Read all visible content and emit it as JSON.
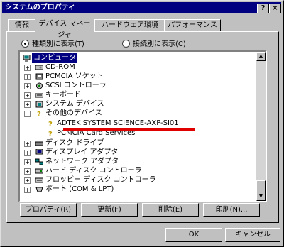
{
  "window": {
    "title": "システムのプロパティ",
    "help_btn": "?",
    "close_btn": "×"
  },
  "tabs": [
    {
      "label": "情報",
      "active": false
    },
    {
      "label": "デバイス マネージャ",
      "active": true
    },
    {
      "label": "ハードウェア環境",
      "active": false
    },
    {
      "label": "パフォーマンス",
      "active": false
    }
  ],
  "view": {
    "by_type": "種類別に表示(T)",
    "by_connection": "接続別に表示(C)",
    "selected": "by_type"
  },
  "tree": [
    {
      "label": "コンピュータ",
      "selected": true,
      "icon": "computer-icon"
    },
    {
      "label": "CD-ROM",
      "icon": "cdrom-icon"
    },
    {
      "label": "PCMCIA ソケット",
      "icon": "pcmcia-icon"
    },
    {
      "label": "SCSI コントローラ",
      "icon": "scsi-icon"
    },
    {
      "label": "キーボード",
      "icon": "keyboard-icon"
    },
    {
      "label": "システム デバイス",
      "icon": "system-device-icon"
    },
    {
      "label": "その他のデバイス",
      "icon": "question-icon"
    },
    {
      "label": "ADTEK SYSTEM SCIENCE-AXP-SI01",
      "icon": "question-icon"
    },
    {
      "label": "PCMCIA Card Services",
      "icon": "question-icon"
    },
    {
      "label": "ディスク ドライブ",
      "icon": "disk-drive-icon"
    },
    {
      "label": "ディスプレイ アダプタ",
      "icon": "display-adapter-icon"
    },
    {
      "label": "ネットワーク アダプタ",
      "icon": "network-adapter-icon"
    },
    {
      "label": "ハード ディスク コントローラ",
      "icon": "hdd-controller-icon"
    },
    {
      "label": "フロッピー ディスク コントローラ",
      "icon": "floppy-controller-icon"
    },
    {
      "label": "ポート (COM & LPT)",
      "icon": "port-icon"
    }
  ],
  "buttons": {
    "properties": "プロパティ(R)",
    "refresh": "更新(F)",
    "remove": "削除(E)",
    "print": "印刷(N)...",
    "ok": "OK",
    "cancel": "キャンセル"
  },
  "colors": {
    "titlebar": "#000080",
    "selection": "#000080",
    "highlight": "#e00000"
  }
}
